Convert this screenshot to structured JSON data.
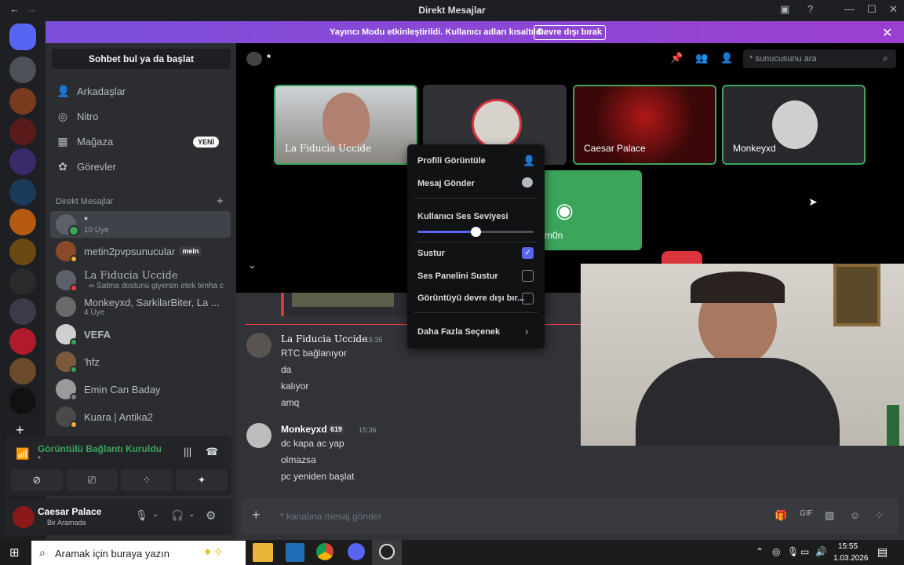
{
  "window": {
    "title": "Direkt Mesajlar"
  },
  "banner": {
    "text": "Yayıncı Modu etkinleştirildi. Kullanıcı adları kısaltıldı.",
    "button": "Devre dışı bırak"
  },
  "sidebar": {
    "search": "Sohbet bul ya da başlat",
    "nav": [
      {
        "label": "Arkadaşlar"
      },
      {
        "label": "Nitro"
      },
      {
        "label": "Mağaza",
        "badge": "YENİ"
      },
      {
        "label": "Görevler"
      }
    ],
    "dm_header": "Direkt Mesajlar",
    "dms": [
      {
        "name": "*",
        "sub": "10 Üye"
      },
      {
        "name": "metin2pvpsunucular",
        "tag": "mein"
      },
      {
        "name": "La Fiducia Uccide",
        "sub": "· ∞ Satma dostunu giyersin etek tenha c"
      },
      {
        "name": "Monkeyxd, SarkilarBiter, La ...",
        "sub": "4 Üye"
      },
      {
        "name": "VEFA"
      },
      {
        "name": "'hfz"
      },
      {
        "name": "Emin Can Baday"
      },
      {
        "name": "Kuara | Antika2"
      }
    ],
    "voice": {
      "status": "Görüntülü Bağlantı Kuruldu",
      "channel": "*"
    },
    "user": {
      "name": "Caesar Palace",
      "status": "Bir Aramada"
    }
  },
  "header": {
    "channel": "*",
    "search_placeholder": "* sunucusunu ara"
  },
  "tiles": [
    "La Fiducia Uccide",
    "",
    "Caesar Palace",
    "Monkeyxd"
  ],
  "discord_tile": {
    "label": "m0n"
  },
  "context_menu": {
    "profile": "Profili Görüntüle",
    "message": "Mesaj Gönder",
    "volume": "Kullanıcı Ses Seviyesi",
    "mute": "Sustur",
    "soundboard": "Ses Panelini Sustur",
    "disable_video": "Görüntüyü devre dışı bır...",
    "more": "Daha Fazla Seçenek"
  },
  "messages": [
    {
      "author": "La Fiducia Uccide",
      "time": "15:35",
      "lines": [
        "RTC bağlanıyor",
        "da",
        "kalıyor",
        "amq"
      ]
    },
    {
      "author": "Monkeyxd",
      "badge": "619",
      "time": "15:36",
      "lines": [
        "dc kapa ac yap",
        "olmazsa",
        "pc yeniden başlat"
      ]
    }
  ],
  "composer": {
    "placeholder": "* kanalına mesaj gönder"
  },
  "taskbar": {
    "search": "Aramak için buraya yazın",
    "time": "15:55",
    "date": "1.03.2026"
  }
}
